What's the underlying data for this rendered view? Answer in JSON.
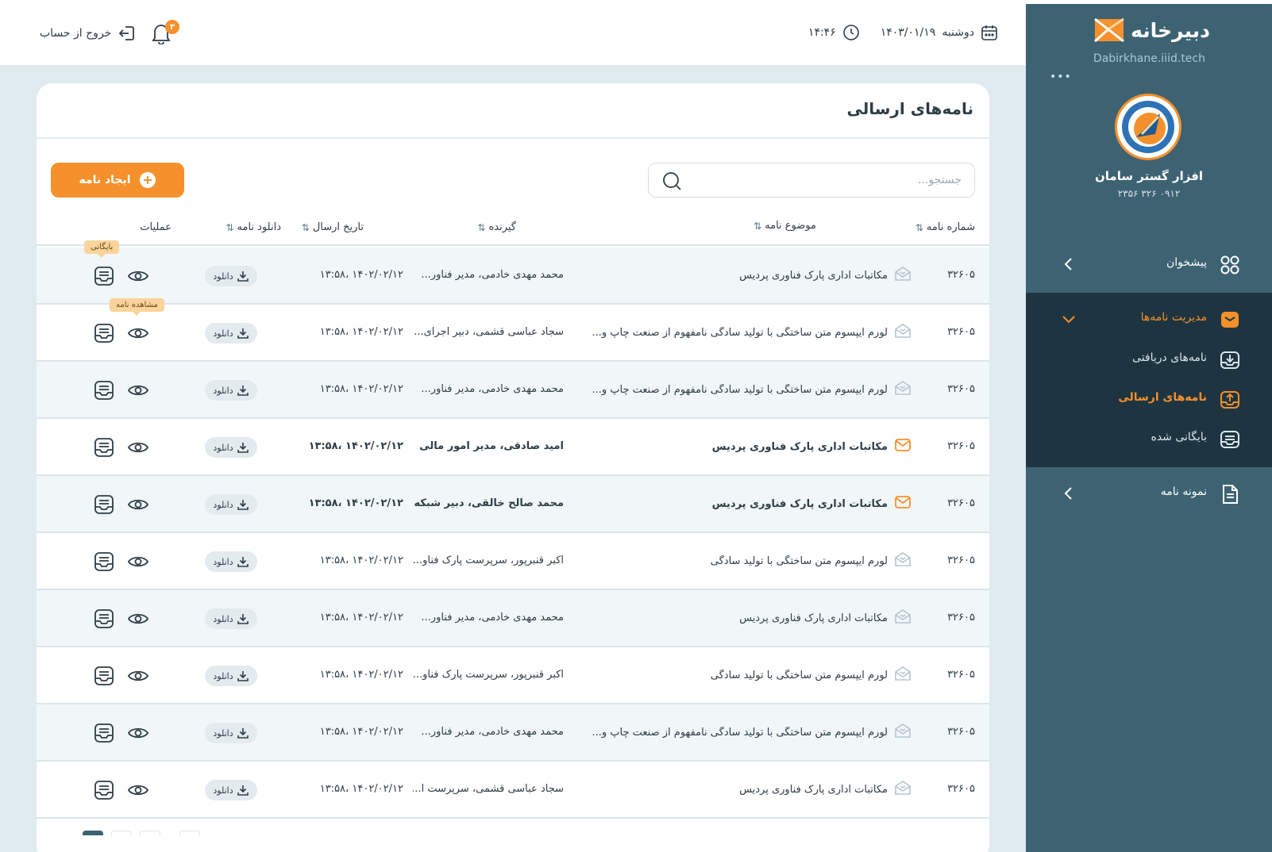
{
  "sidebar": {
    "brand_name": "دبیرخانه",
    "brand_url": "Dabirkhane.iiid.tech",
    "more": "•••",
    "company_name": "افزار گستر سامان",
    "company_phone": "۰۹۱۲ ۳۲۶ ۲۳۵۶",
    "nav": {
      "dashboard": "پیشخوان",
      "letters_management": "مدیریت نامه‌ها",
      "received": "نامه‌های دریافتی",
      "sent": "نامه‌های ارسالی",
      "archived": "بایگانی شده",
      "templates": "نمونه نامه"
    }
  },
  "header": {
    "logout_label": "خروج از حساب",
    "notifications_count": "۳",
    "day": "دوشنبه",
    "date": "۱۴۰۳/۰۱/۱۹",
    "time": "۱۴:۴۶"
  },
  "page": {
    "title": "نامه‌های ارسالی",
    "search_placeholder": "جستجو...",
    "create_label": "ایجاد نامه"
  },
  "table": {
    "headers": {
      "number": "شماره نامه",
      "subject": "موضوع نامه",
      "recipient": "گیرنده",
      "date": "تاریخ ارسال",
      "download": "دانلود نامه",
      "actions": "عملیات"
    },
    "download_label": "دانلود",
    "tooltip_archive": "بایگانی",
    "tooltip_view": "مشاهده نامه",
    "rows": [
      {
        "number": "۳۲۶۰۵",
        "subject": "مکاتبات اداری پارک فناوری پردیس",
        "recipient": "محمد مهدی خادمی، مدیر فناور...",
        "date": "۱۴۰۲/۰۲/۱۲ ،۱۳:۵۸",
        "unread": false
      },
      {
        "number": "۳۲۶۰۵",
        "subject": "لورم ایپسوم متن ساختگی با تولید سادگی نامفهوم از صنعت چاپ و...",
        "recipient": "سجاد عباسی قشمی، دبیر اجرای...",
        "date": "۱۴۰۲/۰۲/۱۲ ،۱۳:۵۸",
        "unread": false
      },
      {
        "number": "۳۲۶۰۵",
        "subject": "لورم ایپسوم متن ساختگی با تولید سادگی نامفهوم از صنعت چاپ و...",
        "recipient": "محمد مهدی خادمی، مدیر فناور...",
        "date": "۱۴۰۲/۰۲/۱۲ ،۱۳:۵۸",
        "unread": false
      },
      {
        "number": "۳۲۶۰۵",
        "subject": "مکاتبات اداری پارک فناوری پردیس",
        "recipient": "امید صادقی، مدیر امور مالی",
        "date": "۱۴۰۲/۰۲/۱۲ ،۱۳:۵۸",
        "unread": true
      },
      {
        "number": "۳۲۶۰۵",
        "subject": "مکاتبات اداری پارک فناوری پردیس",
        "recipient": "محمد صالح خالقی، دبیر شبکه فن...",
        "date": "۱۴۰۲/۰۲/۱۲ ،۱۳:۵۸",
        "unread": true
      },
      {
        "number": "۳۲۶۰۵",
        "subject": "لورم ایپسوم متن ساختگی با تولید سادگی",
        "recipient": "اکبر قنبرپور، سرپرست پارک فناو...",
        "date": "۱۴۰۲/۰۲/۱۲ ،۱۳:۵۸",
        "unread": false
      },
      {
        "number": "۳۲۶۰۵",
        "subject": "مکاتبات اداری پارک فناوری پردیس",
        "recipient": "محمد مهدی خادمی، مدیر فناور...",
        "date": "۱۴۰۲/۰۲/۱۲ ،۱۳:۵۸",
        "unread": false
      },
      {
        "number": "۳۲۶۰۵",
        "subject": "لورم ایپسوم متن ساختگی با تولید سادگی",
        "recipient": "اکبر قنبرپور، سرپرست پارک فناو...",
        "date": "۱۴۰۲/۰۲/۱۲ ،۱۳:۵۸",
        "unread": false
      },
      {
        "number": "۳۲۶۰۵",
        "subject": "لورم ایپسوم متن ساختگی با تولید سادگی نامفهوم از صنعت چاپ و...",
        "recipient": "محمد مهدی خادمی، مدیر فناور...",
        "date": "۱۴۰۲/۰۲/۱۲ ،۱۳:۵۸",
        "unread": false
      },
      {
        "number": "۳۲۶۰۵",
        "subject": "مکاتبات اداری پارک فناوری پردیس",
        "recipient": "سجاد عباسی قشمی، سرپرست ا...",
        "date": "۱۴۰۲/۰۲/۱۲ ،۱۳:۵۸",
        "unread": false
      }
    ]
  },
  "colors": {
    "accent": "#f5912c",
    "sidebar_bg": "#3d6373",
    "submenu_bg": "#1e3541",
    "content_bg": "#e0ebf0",
    "row_alt": "#f1f6f9"
  },
  "icons": {
    "letter_read": "envelope-open-icon",
    "letter_unread": "envelope-icon",
    "view": "eye-icon",
    "archive": "archive-tray-icon",
    "download": "download-icon"
  }
}
